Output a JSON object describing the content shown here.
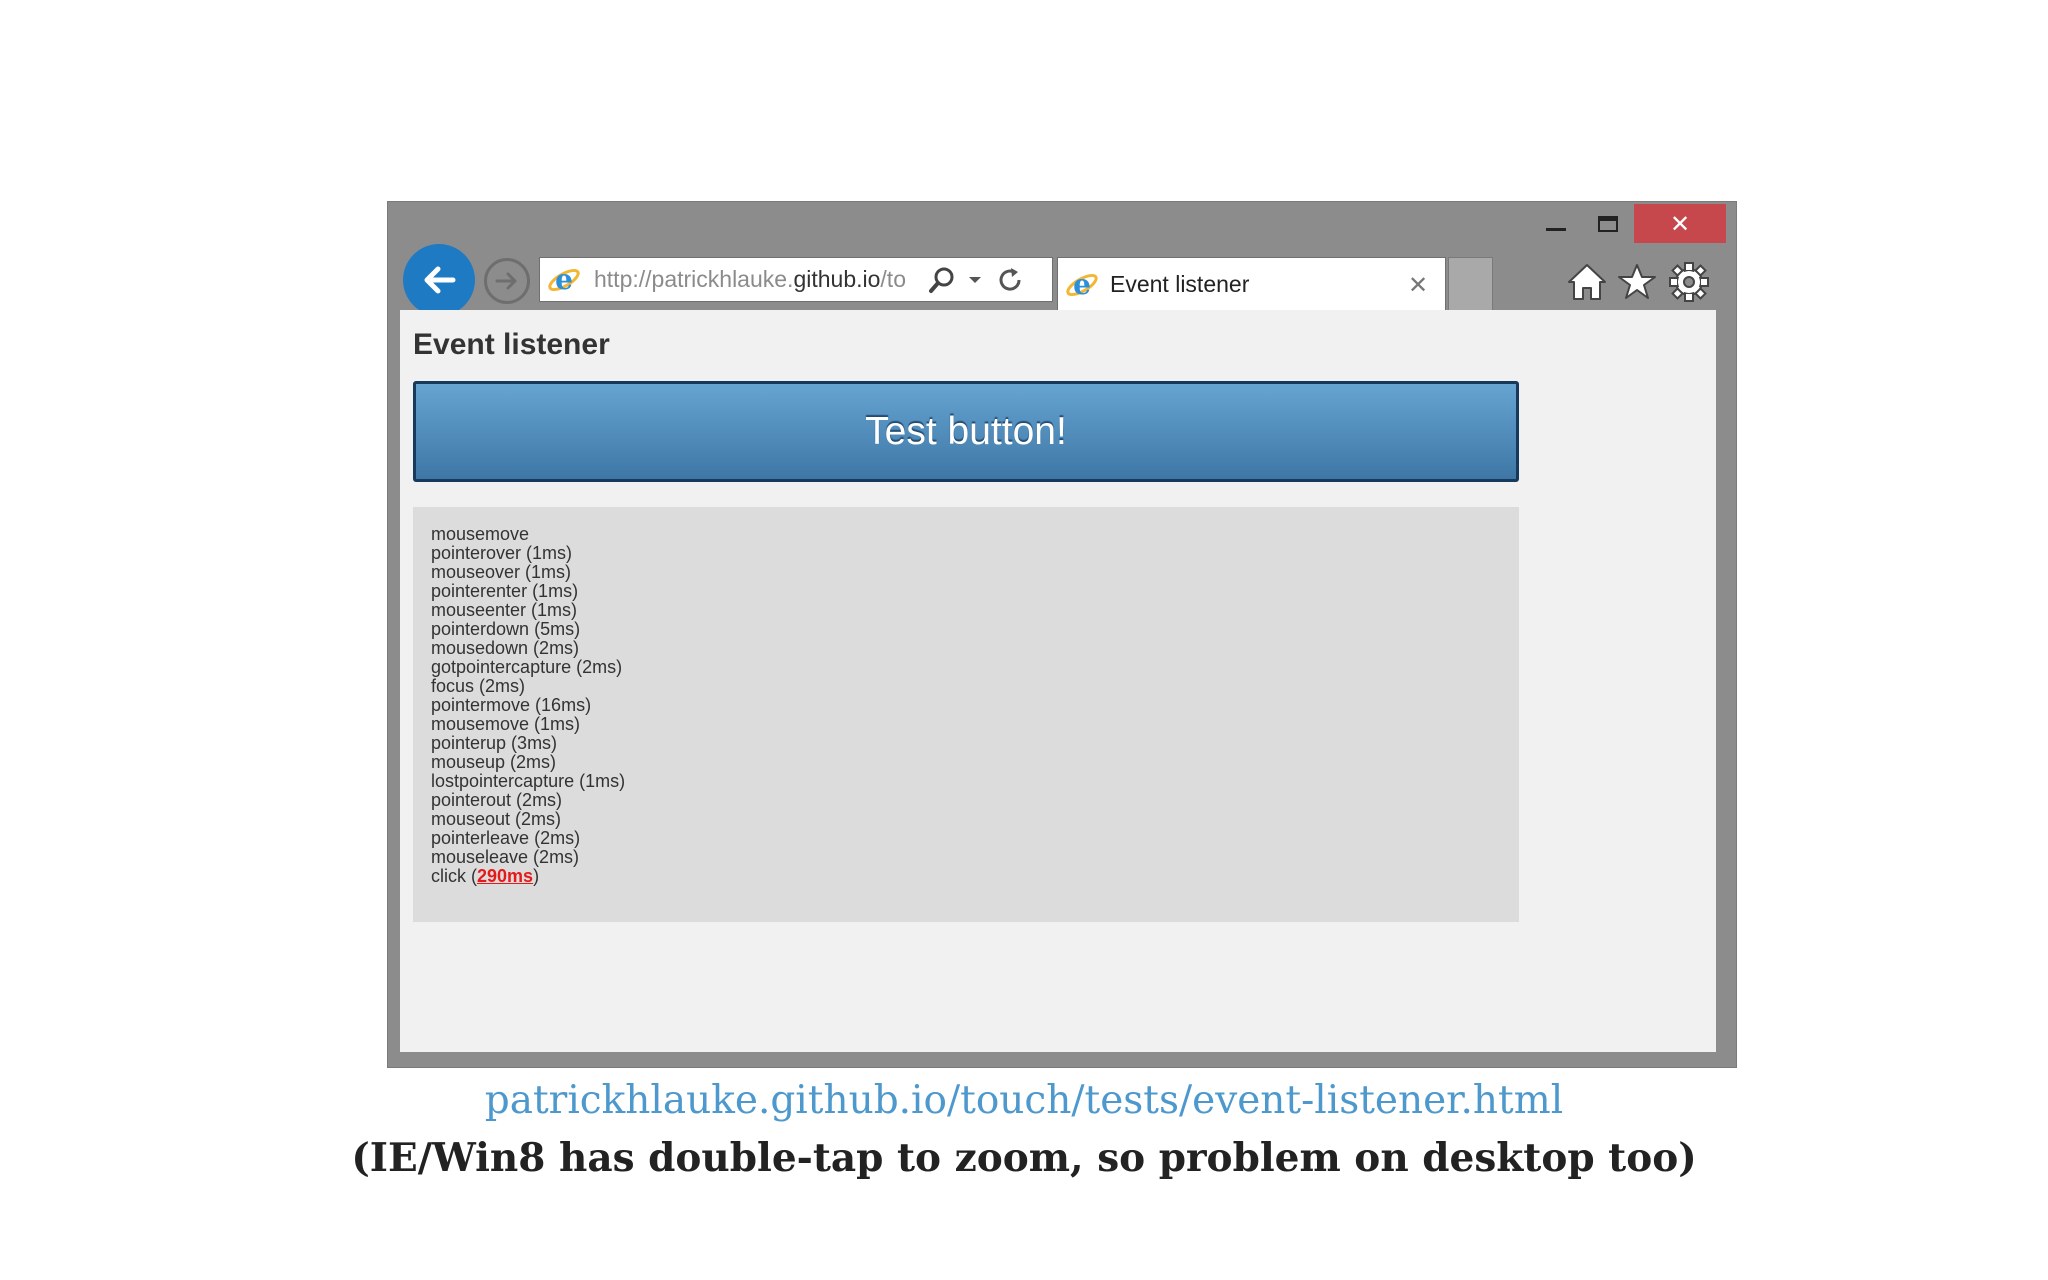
{
  "browser": {
    "window_controls": {
      "close_glyph": "✕"
    },
    "address_bar": {
      "url_prefix": "http://patrickhlauke.",
      "url_host": "github.io",
      "url_suffix": "/to"
    },
    "tab": {
      "title": "Event listener",
      "close_glyph": "✕"
    },
    "icons": [
      "back-arrow-icon",
      "forward-arrow-icon",
      "ie-logo-icon",
      "search-icon",
      "dropdown-arrow-icon",
      "refresh-icon",
      "home-icon",
      "favorites-star-icon",
      "settings-gear-icon"
    ],
    "colors": {
      "frame": "#8c8c8c",
      "close": "#c7484c",
      "back": "#1f7ac4"
    }
  },
  "page": {
    "heading": "Event listener",
    "button_label": "Test button!",
    "log": [
      "mousemove",
      "pointerover (1ms)",
      "mouseover (1ms)",
      "pointerenter (1ms)",
      "mouseenter (1ms)",
      "pointerdown (5ms)",
      "mousedown (2ms)",
      "gotpointercapture (2ms)",
      "focus (2ms)",
      "pointermove (16ms)",
      "mousemove (1ms)",
      "pointerup (3ms)",
      "mouseup (2ms)",
      "lostpointercapture (1ms)",
      "pointerout (2ms)",
      "mouseout (2ms)",
      "pointerleave (2ms)",
      "mouseleave (2ms)"
    ],
    "last_log": {
      "label": "click (",
      "value": "290ms",
      "close": ")"
    }
  },
  "caption": {
    "url": "patrickhlauke.github.io/touch/tests/event-listener.html",
    "note": "(IE/Win8 has double-tap to zoom, so problem on desktop too)"
  }
}
